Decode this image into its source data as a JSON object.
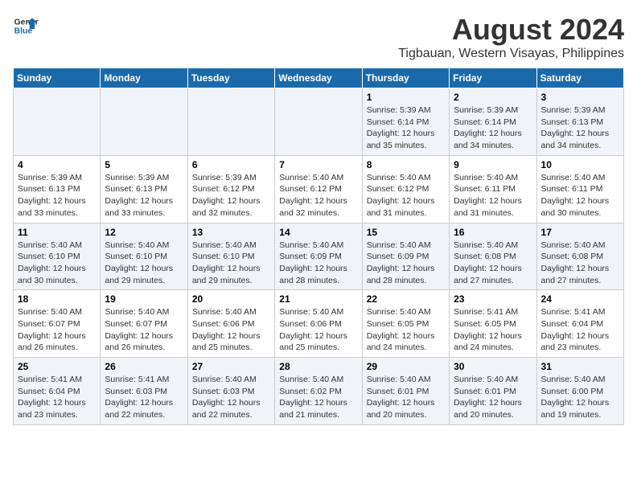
{
  "logo": {
    "line1": "General",
    "line2": "Blue"
  },
  "title": "August 2024",
  "subtitle": "Tigbauan, Western Visayas, Philippines",
  "days_of_week": [
    "Sunday",
    "Monday",
    "Tuesday",
    "Wednesday",
    "Thursday",
    "Friday",
    "Saturday"
  ],
  "weeks": [
    [
      {
        "day": "",
        "info": ""
      },
      {
        "day": "",
        "info": ""
      },
      {
        "day": "",
        "info": ""
      },
      {
        "day": "",
        "info": ""
      },
      {
        "day": "1",
        "info": "Sunrise: 5:39 AM\nSunset: 6:14 PM\nDaylight: 12 hours\nand 35 minutes."
      },
      {
        "day": "2",
        "info": "Sunrise: 5:39 AM\nSunset: 6:14 PM\nDaylight: 12 hours\nand 34 minutes."
      },
      {
        "day": "3",
        "info": "Sunrise: 5:39 AM\nSunset: 6:13 PM\nDaylight: 12 hours\nand 34 minutes."
      }
    ],
    [
      {
        "day": "4",
        "info": "Sunrise: 5:39 AM\nSunset: 6:13 PM\nDaylight: 12 hours\nand 33 minutes."
      },
      {
        "day": "5",
        "info": "Sunrise: 5:39 AM\nSunset: 6:13 PM\nDaylight: 12 hours\nand 33 minutes."
      },
      {
        "day": "6",
        "info": "Sunrise: 5:39 AM\nSunset: 6:12 PM\nDaylight: 12 hours\nand 32 minutes."
      },
      {
        "day": "7",
        "info": "Sunrise: 5:40 AM\nSunset: 6:12 PM\nDaylight: 12 hours\nand 32 minutes."
      },
      {
        "day": "8",
        "info": "Sunrise: 5:40 AM\nSunset: 6:12 PM\nDaylight: 12 hours\nand 31 minutes."
      },
      {
        "day": "9",
        "info": "Sunrise: 5:40 AM\nSunset: 6:11 PM\nDaylight: 12 hours\nand 31 minutes."
      },
      {
        "day": "10",
        "info": "Sunrise: 5:40 AM\nSunset: 6:11 PM\nDaylight: 12 hours\nand 30 minutes."
      }
    ],
    [
      {
        "day": "11",
        "info": "Sunrise: 5:40 AM\nSunset: 6:10 PM\nDaylight: 12 hours\nand 30 minutes."
      },
      {
        "day": "12",
        "info": "Sunrise: 5:40 AM\nSunset: 6:10 PM\nDaylight: 12 hours\nand 29 minutes."
      },
      {
        "day": "13",
        "info": "Sunrise: 5:40 AM\nSunset: 6:10 PM\nDaylight: 12 hours\nand 29 minutes."
      },
      {
        "day": "14",
        "info": "Sunrise: 5:40 AM\nSunset: 6:09 PM\nDaylight: 12 hours\nand 28 minutes."
      },
      {
        "day": "15",
        "info": "Sunrise: 5:40 AM\nSunset: 6:09 PM\nDaylight: 12 hours\nand 28 minutes."
      },
      {
        "day": "16",
        "info": "Sunrise: 5:40 AM\nSunset: 6:08 PM\nDaylight: 12 hours\nand 27 minutes."
      },
      {
        "day": "17",
        "info": "Sunrise: 5:40 AM\nSunset: 6:08 PM\nDaylight: 12 hours\nand 27 minutes."
      }
    ],
    [
      {
        "day": "18",
        "info": "Sunrise: 5:40 AM\nSunset: 6:07 PM\nDaylight: 12 hours\nand 26 minutes."
      },
      {
        "day": "19",
        "info": "Sunrise: 5:40 AM\nSunset: 6:07 PM\nDaylight: 12 hours\nand 26 minutes."
      },
      {
        "day": "20",
        "info": "Sunrise: 5:40 AM\nSunset: 6:06 PM\nDaylight: 12 hours\nand 25 minutes."
      },
      {
        "day": "21",
        "info": "Sunrise: 5:40 AM\nSunset: 6:06 PM\nDaylight: 12 hours\nand 25 minutes."
      },
      {
        "day": "22",
        "info": "Sunrise: 5:40 AM\nSunset: 6:05 PM\nDaylight: 12 hours\nand 24 minutes."
      },
      {
        "day": "23",
        "info": "Sunrise: 5:41 AM\nSunset: 6:05 PM\nDaylight: 12 hours\nand 24 minutes."
      },
      {
        "day": "24",
        "info": "Sunrise: 5:41 AM\nSunset: 6:04 PM\nDaylight: 12 hours\nand 23 minutes."
      }
    ],
    [
      {
        "day": "25",
        "info": "Sunrise: 5:41 AM\nSunset: 6:04 PM\nDaylight: 12 hours\nand 23 minutes."
      },
      {
        "day": "26",
        "info": "Sunrise: 5:41 AM\nSunset: 6:03 PM\nDaylight: 12 hours\nand 22 minutes."
      },
      {
        "day": "27",
        "info": "Sunrise: 5:40 AM\nSunset: 6:03 PM\nDaylight: 12 hours\nand 22 minutes."
      },
      {
        "day": "28",
        "info": "Sunrise: 5:40 AM\nSunset: 6:02 PM\nDaylight: 12 hours\nand 21 minutes."
      },
      {
        "day": "29",
        "info": "Sunrise: 5:40 AM\nSunset: 6:01 PM\nDaylight: 12 hours\nand 20 minutes."
      },
      {
        "day": "30",
        "info": "Sunrise: 5:40 AM\nSunset: 6:01 PM\nDaylight: 12 hours\nand 20 minutes."
      },
      {
        "day": "31",
        "info": "Sunrise: 5:40 AM\nSunset: 6:00 PM\nDaylight: 12 hours\nand 19 minutes."
      }
    ]
  ]
}
